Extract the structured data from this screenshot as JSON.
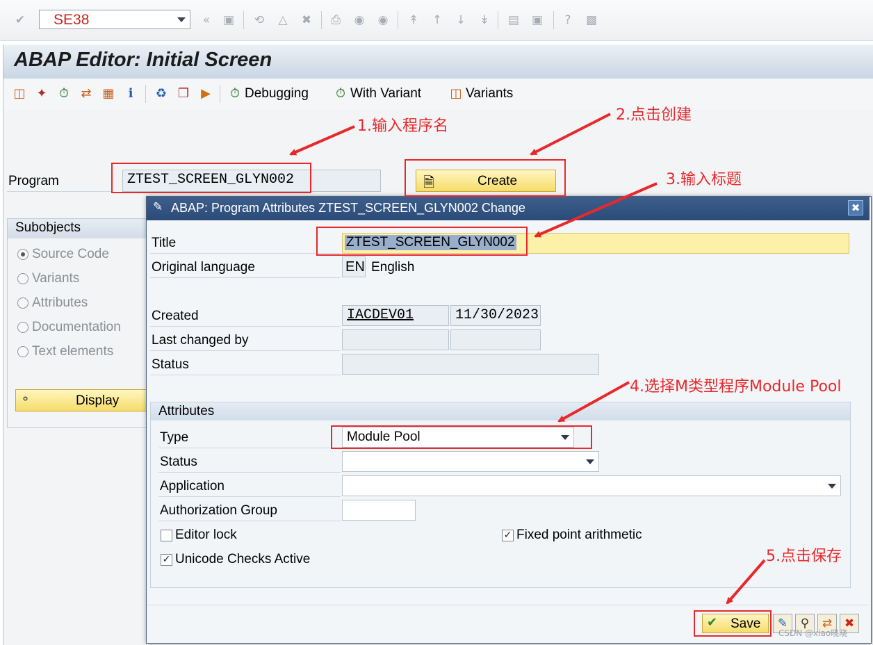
{
  "system": {
    "tcode": "SE38"
  },
  "page": {
    "title": "ABAP Editor: Initial Screen"
  },
  "app_toolbar": {
    "debugging": "Debugging",
    "with_variant": "With Variant",
    "variants": "Variants"
  },
  "initial": {
    "program_label": "Program",
    "program_value": "ZTEST_SCREEN_GLYN002",
    "create_label": "Create",
    "subobjects_title": "Subobjects",
    "subobjects": [
      "Source Code",
      "Variants",
      "Attributes",
      "Documentation",
      "Text elements"
    ],
    "selected_subobject": "Source Code",
    "display_label": "Display"
  },
  "dialog": {
    "title": "ABAP: Program Attributes ZTEST_SCREEN_GLYN002 Change",
    "title_label": "Title",
    "title_value": "ZTEST_SCREEN_GLYN002",
    "orig_lang_label": "Original language",
    "orig_lang_code": "EN",
    "orig_lang_name": "English",
    "created_label": "Created",
    "created_by": "IACDEV01",
    "created_on": "11/30/2023",
    "last_changed_label": "Last changed by",
    "status_label": "Status",
    "attributes": {
      "group_title": "Attributes",
      "type_label": "Type",
      "type_value": "Module Pool",
      "status_label": "Status",
      "application_label": "Application",
      "auth_group_label": "Authorization Group",
      "editor_lock_label": "Editor lock",
      "editor_lock_checked": false,
      "fixed_point_label": "Fixed point arithmetic",
      "fixed_point_checked": true,
      "unicode_label": "Unicode Checks Active",
      "unicode_checked": true
    },
    "save_label": "Save"
  },
  "annotations": {
    "step1": "1.输入程序名",
    "step2": "2.点击创建",
    "step3": "3.输入标题",
    "step4": "4.选择M类型程序Module Pool",
    "step5": "5.点击保存"
  },
  "watermark": "CSDN @xiao晓晓",
  "colors": {
    "annotation_red": "#e8292b",
    "dialog_bar": "#2f5080",
    "title_field": "#fdf0a8",
    "button_yellow": "#f6dc6a"
  },
  "icons": {
    "enter": "check-circle-icon",
    "save": "floppy-icon",
    "back": "back-icon",
    "exit": "exit-icon",
    "cancel": "cancel-icon",
    "print": "print-icon",
    "find": "binoculars-icon",
    "help": "help-icon"
  }
}
